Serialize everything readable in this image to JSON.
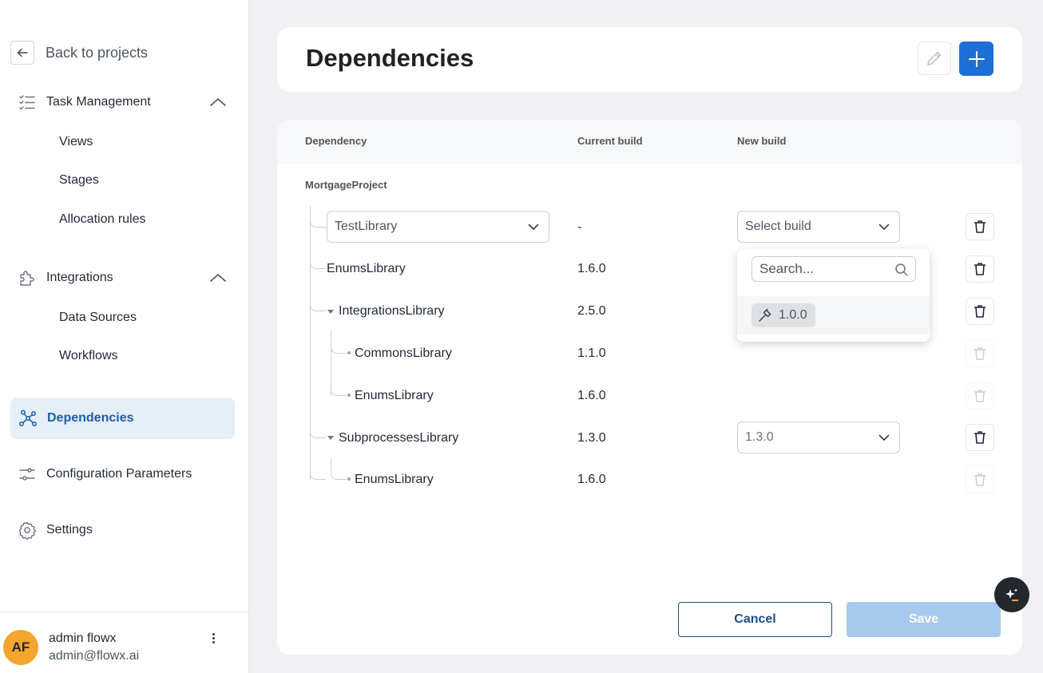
{
  "sidebar": {
    "back_label": "Back to projects",
    "groups": [
      {
        "label": "Task Management",
        "icon": "checklist-icon",
        "items": [
          "Views",
          "Stages",
          "Allocation rules"
        ]
      },
      {
        "label": "Integrations",
        "icon": "puzzle-icon",
        "items": [
          "Data Sources",
          "Workflows"
        ]
      }
    ],
    "active_item": "Dependencies",
    "config_label": "Configuration Parameters",
    "settings_label": "Settings",
    "user": {
      "initials": "AF",
      "name": "admin flowx",
      "email": "admin@flowx.ai"
    }
  },
  "header": {
    "title": "Dependencies"
  },
  "table": {
    "columns": {
      "dependency": "Dependency",
      "current": "Current build",
      "new": "New build"
    },
    "project": "MortgageProject",
    "rows": [
      {
        "name": "TestLibrary",
        "current": "-",
        "new_placeholder": "Select build"
      },
      {
        "name": "EnumsLibrary",
        "current": "1.6.0"
      },
      {
        "name": "IntegrationsLibrary",
        "current": "2.5.0"
      },
      {
        "name": "CommonsLibrary",
        "current": "1.1.0"
      },
      {
        "name": "EnumsLibrary",
        "current": "1.6.0"
      },
      {
        "name": "SubprocessesLibrary",
        "current": "1.3.0",
        "new_value": "1.3.0"
      },
      {
        "name": "EnumsLibrary",
        "current": "1.6.0"
      }
    ]
  },
  "dropdown": {
    "search_placeholder": "Search...",
    "option": "1.0.0"
  },
  "actions": {
    "cancel": "Cancel",
    "save": "Save"
  },
  "colors": {
    "primary": "#1d6fd6",
    "active_bg": "#e6eef8",
    "active_text": "#1d5fa6",
    "avatar": "#f4a52d"
  }
}
